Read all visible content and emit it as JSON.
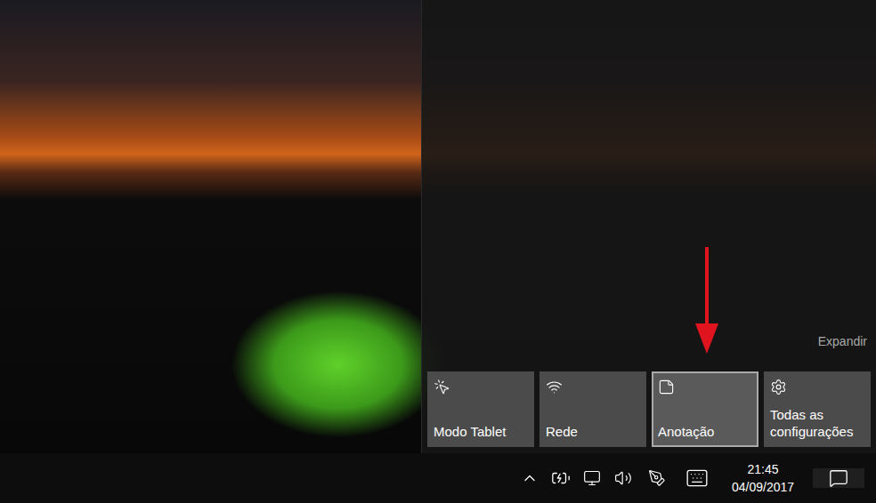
{
  "action_center": {
    "expand_label": "Expandir",
    "tiles": [
      {
        "label": "Modo Tablet",
        "selected": false
      },
      {
        "label": "Rede",
        "selected": false
      },
      {
        "label": "Anotação",
        "selected": true
      },
      {
        "label": "Todas as configurações",
        "selected": false
      }
    ]
  },
  "taskbar": {
    "time": "21:45",
    "date": "04/09/2017",
    "action_center_open": true
  }
}
